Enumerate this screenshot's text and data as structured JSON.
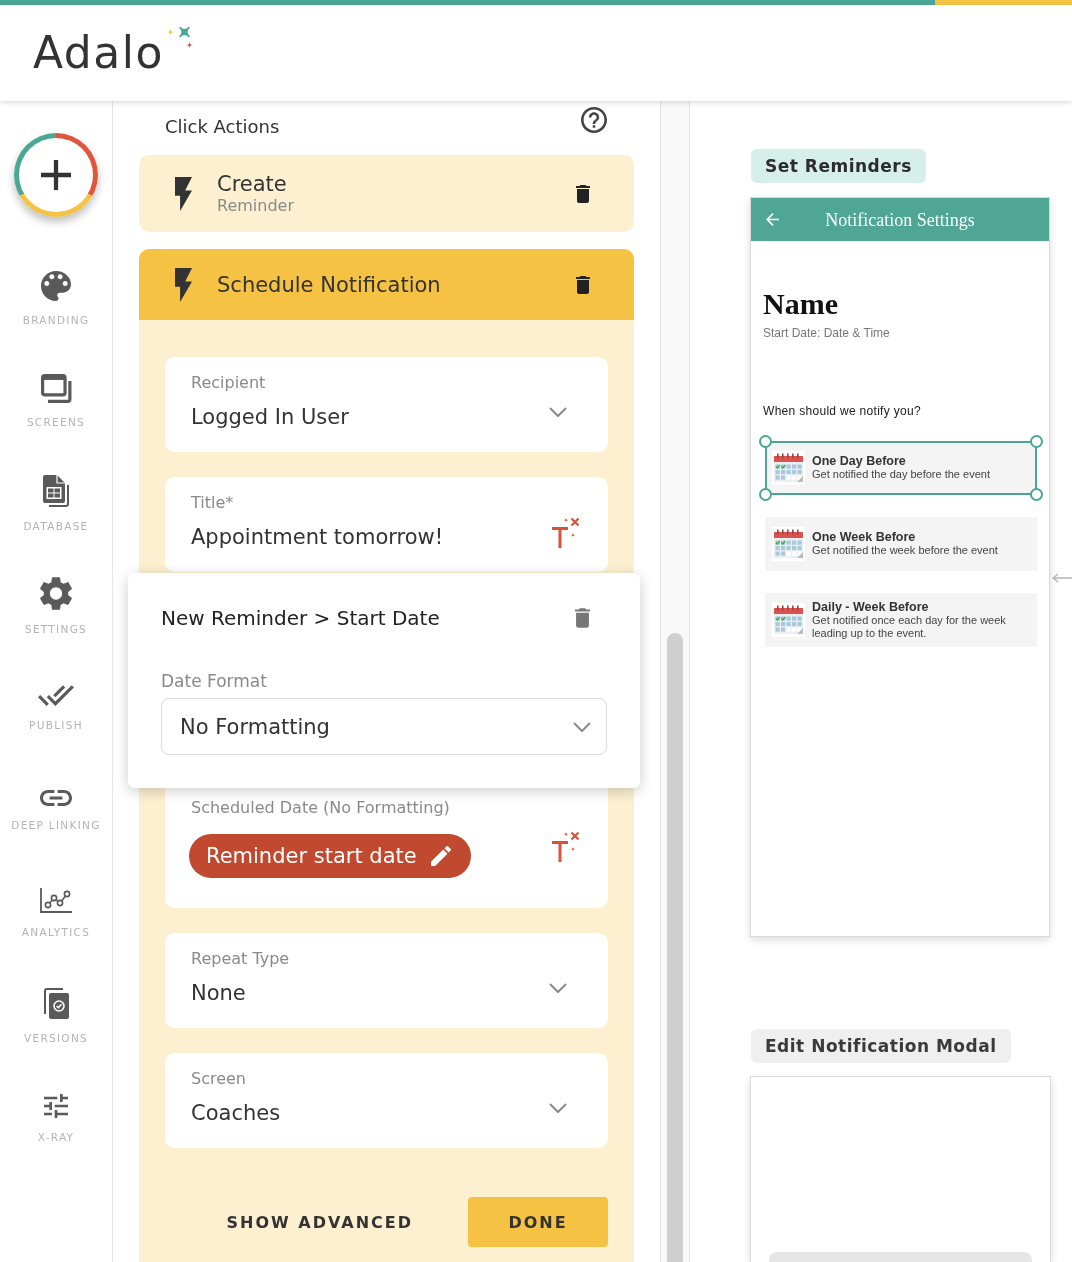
{
  "header": {
    "logo": "Adalo"
  },
  "sidebar": {
    "items": [
      {
        "label": "BRANDING",
        "selected": false
      },
      {
        "label": "SCREENS",
        "selected": false
      },
      {
        "label": "DATABASE",
        "selected": false
      },
      {
        "label": "SETTINGS",
        "selected": false
      },
      {
        "label": "PUBLISH",
        "selected": false
      },
      {
        "label": "DEEP LINKING",
        "selected": false
      },
      {
        "label": "ANALYTICS",
        "selected": false
      },
      {
        "label": "VERSIONS",
        "selected": false
      },
      {
        "label": "X-RAY",
        "selected": false
      }
    ]
  },
  "panel": {
    "title": "Click Actions",
    "actions": [
      {
        "title": "Create",
        "subtitle": "Reminder",
        "expanded": false
      },
      {
        "title": "Schedule Notification",
        "expanded": true,
        "fields": [
          {
            "kind": "select",
            "label": "Recipient",
            "value": "Logged In User"
          },
          {
            "kind": "text",
            "label": "Title*",
            "value": "Appointment tomorrow!"
          },
          {
            "kind": "date",
            "label": "Scheduled Date (No Formatting)",
            "chip": "Reminder start date"
          },
          {
            "kind": "select",
            "label": "Repeat Type",
            "value": "None"
          },
          {
            "kind": "select",
            "label": "Screen",
            "value": "Coaches"
          }
        ],
        "buttons": [
          {
            "kind": "text",
            "label": "SHOW ADVANCED"
          },
          {
            "kind": "primary",
            "label": "DONE"
          }
        ]
      }
    ],
    "popup": {
      "title": "New Reminder > Start Date",
      "label": "Date Format",
      "value": "No Formatting"
    }
  },
  "canvas": {
    "screens": [
      {
        "kind": "page",
        "label": "Set Reminders",
        "selected": true,
        "app_bar": {
          "title": "Notification Settings"
        },
        "heading": "Name",
        "subheading": "Start Date: Date & Time",
        "prompt": "When should we notify you?",
        "options": [
          {
            "title": "One Day Before",
            "description": "Get notified the day before the event",
            "selected": true
          },
          {
            "title": "One Week Before",
            "description": "Get notified the week before the event",
            "selected": false
          },
          {
            "title": "Daily - Week Before",
            "description": "Get notified once each day for the week leading up to the event.",
            "selected": false
          }
        ]
      },
      {
        "kind": "modal",
        "label": "Edit Notification Modal",
        "selected": false
      }
    ]
  }
}
